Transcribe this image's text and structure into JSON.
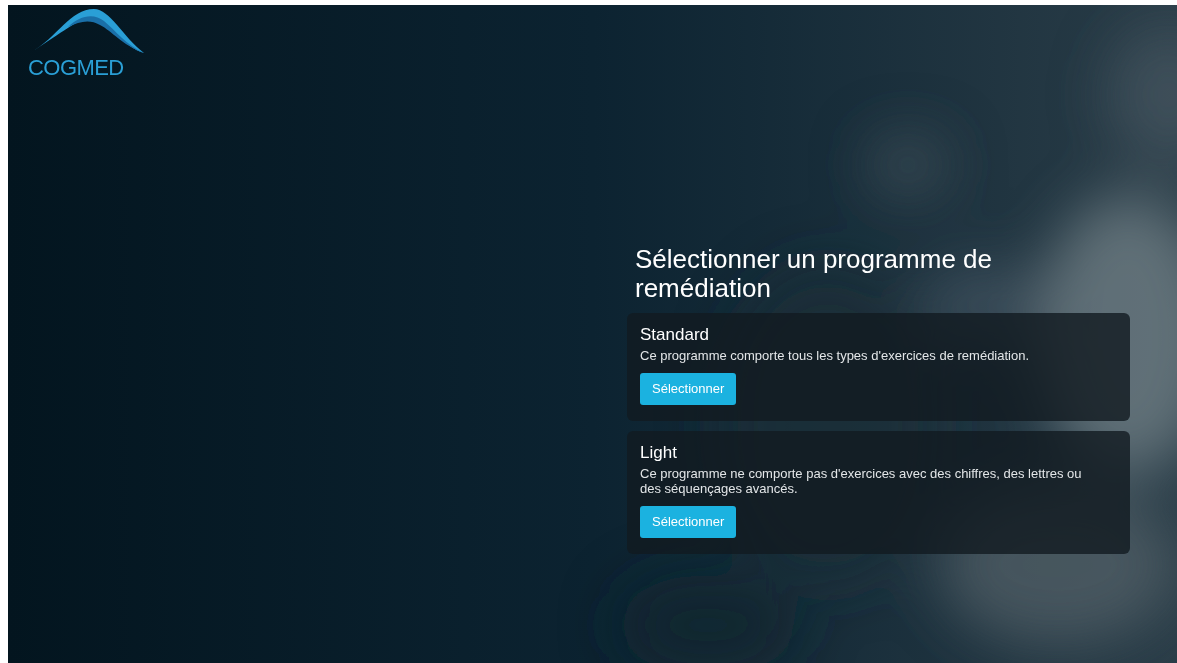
{
  "logo": {
    "text": "COGMED"
  },
  "heading": "Sélectionner un programme de remédiation",
  "programs": [
    {
      "title": "Standard",
      "description": "Ce programme comporte tous les types d'exercices de remédiation.",
      "button": "Sélectionner"
    },
    {
      "title": "Light",
      "description": "Ce programme ne comporte pas d'exercices avec des chiffres, des lettres ou des séquençages avancés.",
      "button": "Sélectionner"
    }
  ]
}
